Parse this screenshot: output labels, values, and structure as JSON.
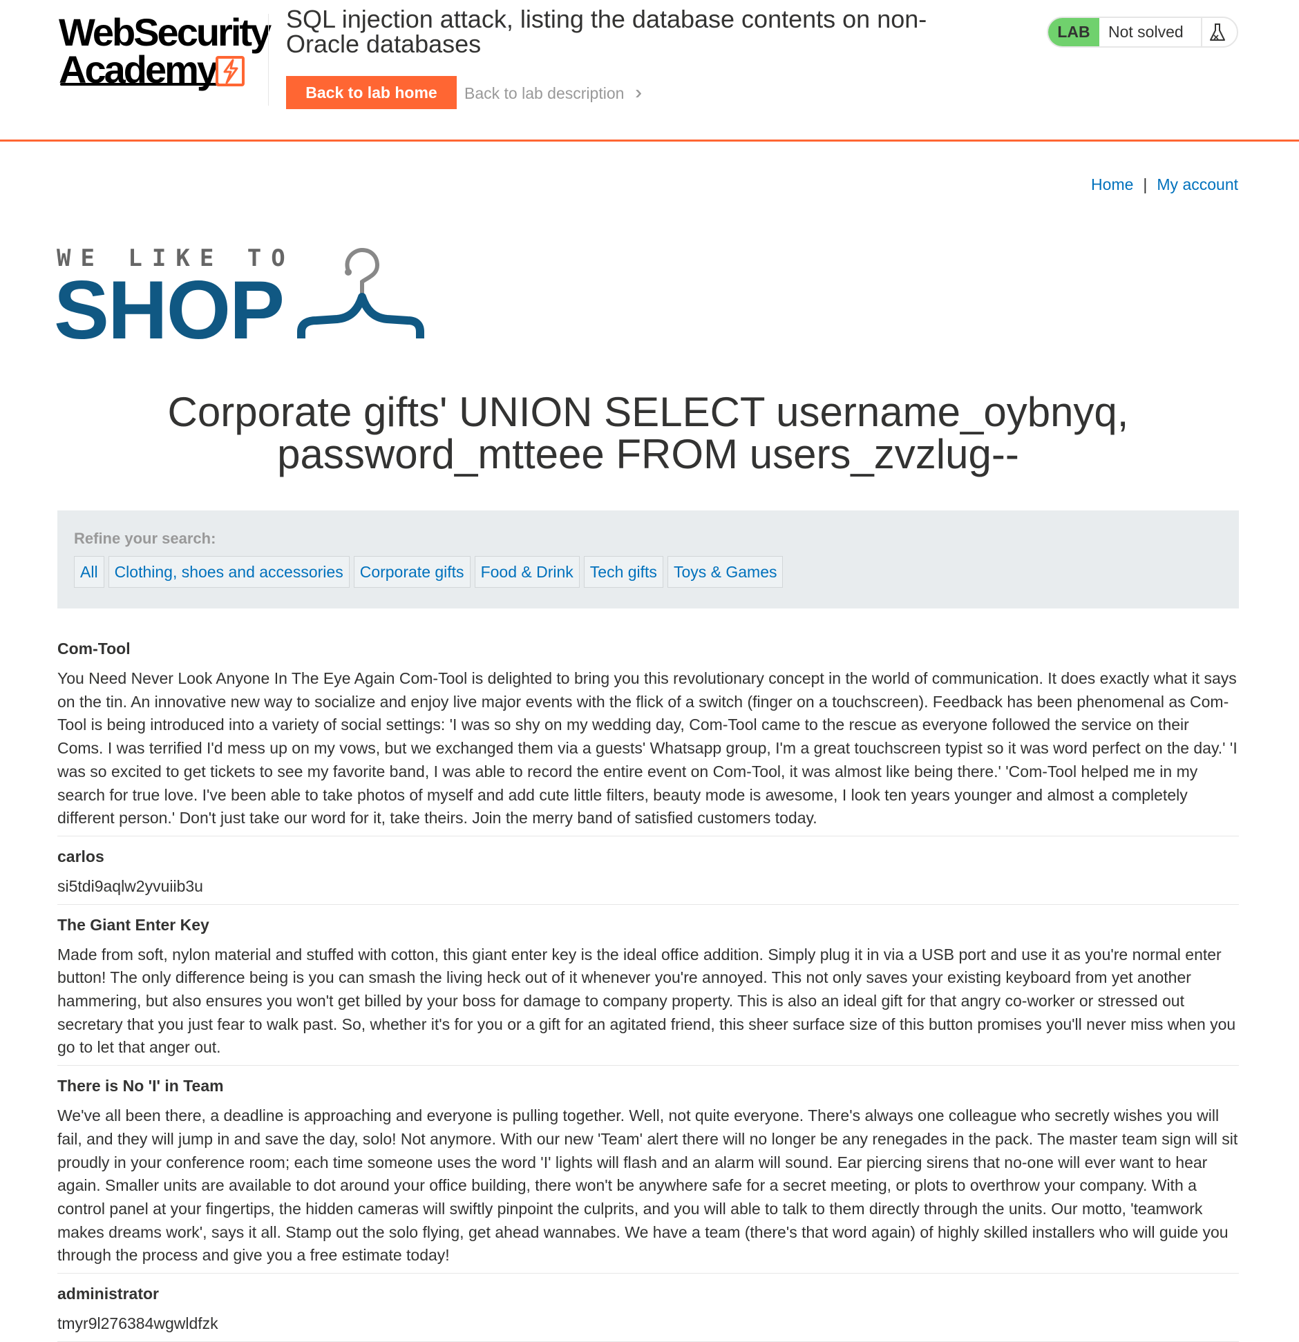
{
  "academy": {
    "logo_line1": "WebSecurity",
    "logo_line2": "Academy",
    "lab_title": "SQL injection attack, listing the database contents on non-Oracle databases",
    "back_home_label": "Back to lab home",
    "back_description_label": "Back to lab description",
    "status_tag": "LAB",
    "status_text": "Not solved",
    "status_icon": "flask-icon",
    "accent_color": "#ff6633",
    "status_color": "#70d16d"
  },
  "nav": {
    "home_label": "Home",
    "separator": "|",
    "account_label": "My account",
    "link_color": "#0071bc"
  },
  "shop_logo": {
    "tagline": "WE LIKE TO",
    "word": "SHOP",
    "icon": "hanger-icon",
    "brand_color": "#105883"
  },
  "page": {
    "heading": "Corporate gifts' UNION SELECT username_oybnyq, password_mtteee FROM users_zvzlug--"
  },
  "filters": {
    "label": "Refine your search:",
    "items": [
      "All",
      "Clothing, shoes and accessories",
      "Corporate gifts",
      "Food & Drink",
      "Tech gifts",
      "Toys & Games"
    ]
  },
  "results": [
    {
      "head": "Com-Tool",
      "body": "You Need Never Look Anyone In The Eye Again Com-Tool is delighted to bring you this revolutionary concept in the world of communication. It does exactly what it says on the tin. An innovative new way to socialize and enjoy live major events with the flick of a switch (finger on a touchscreen). Feedback has been phenomenal as Com-Tool is being introduced into a variety of social settings: 'I was so shy on my wedding day, Com-Tool came to the rescue as everyone followed the service on their Coms. I was terrified I'd mess up on my vows, but we exchanged them via a guests' Whatsapp group, I'm a great touchscreen typist so it was word perfect on the day.' 'I was so excited to get tickets to see my favorite band, I was able to record the entire event on Com-Tool, it was almost like being there.' 'Com-Tool helped me in my search for true love. I've been able to take photos of myself and add cute little filters, beauty mode is awesome, I look ten years younger and almost a completely different person.' Don't just take our word for it, take theirs. Join the merry band of satisfied customers today."
    },
    {
      "head": "carlos",
      "body": "si5tdi9aqlw2yvuiib3u"
    },
    {
      "head": "The Giant Enter Key",
      "body": "Made from soft, nylon material and stuffed with cotton, this giant enter key is the ideal office addition. Simply plug it in via a USB port and use it as you're normal enter button! The only difference being is you can smash the living heck out of it whenever you're annoyed. This not only saves your existing keyboard from yet another hammering, but also ensures you won't get billed by your boss for damage to company property. This is also an ideal gift for that angry co-worker or stressed out secretary that you just fear to walk past. So, whether it's for you or a gift for an agitated friend, this sheer surface size of this button promises you'll never miss when you go to let that anger out."
    },
    {
      "head": "There is No 'I' in Team",
      "body": "We've all been there, a deadline is approaching and everyone is pulling together. Well, not quite everyone. There's always one colleague who secretly wishes you will fail, and they will jump in and save the day, solo! Not anymore. With our new 'Team' alert there will no longer be any renegades in the pack. The master team sign will sit proudly in your conference room; each time someone uses the word 'I' lights will flash and an alarm will sound. Ear piercing sirens that no-one will ever want to hear again. Smaller units are available to dot around your office building, there won't be anywhere safe for a secret meeting, or plots to overthrow your company. With a control panel at your fingertips, the hidden cameras will swiftly pinpoint the culprits, and you will able to talk to them directly through the units. Our motto, 'teamwork makes dreams work', says it all. Stamp out the solo flying, get ahead wannabes. We have a team (there's that word again) of highly skilled installers who will guide you through the process and give you a free estimate today!"
    },
    {
      "head": "administrator",
      "body": "tmyr9l276384wgwldfzk"
    }
  ]
}
